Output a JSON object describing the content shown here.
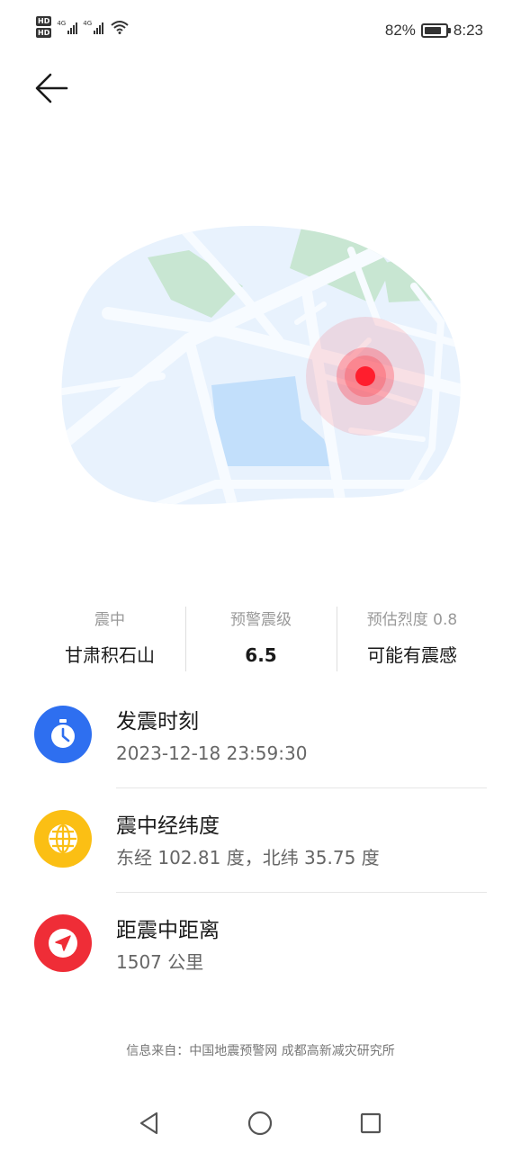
{
  "status_bar": {
    "hd1": "HD",
    "hd2": "HD",
    "net1": "4G",
    "net2": "4G",
    "battery_percent_text": "82%",
    "battery_level": 0.82,
    "time": "8:23"
  },
  "map": {
    "alt": "",
    "epicenter_color": "#ff1e2d"
  },
  "summary": {
    "epicenter_label": "震中",
    "epicenter_value": "甘肃积石山",
    "magnitude_label": "预警震级",
    "magnitude_value": "6.5",
    "intensity_label": "预估烈度 0.8",
    "intensity_value": "可能有震感"
  },
  "info": {
    "time": {
      "title": "发震时刻",
      "value": "2023-12-18 23:59:30",
      "icon": "stopwatch-icon",
      "color": "#2e6ff0"
    },
    "coords": {
      "title": "震中经纬度",
      "value": "东经 102.81 度，北纬 35.75 度",
      "icon": "globe-icon",
      "color": "#fbbf14"
    },
    "distance": {
      "title": "距震中距离",
      "value": "1507 公里",
      "icon": "navigation-arrow-icon",
      "color": "#ef2d37"
    }
  },
  "footer": {
    "source": "信息来自：中国地震预警网 成都高新减灾研究所"
  },
  "nav": {
    "back": "back-triangle-icon",
    "home": "home-circle-icon",
    "recents": "recents-square-icon"
  }
}
